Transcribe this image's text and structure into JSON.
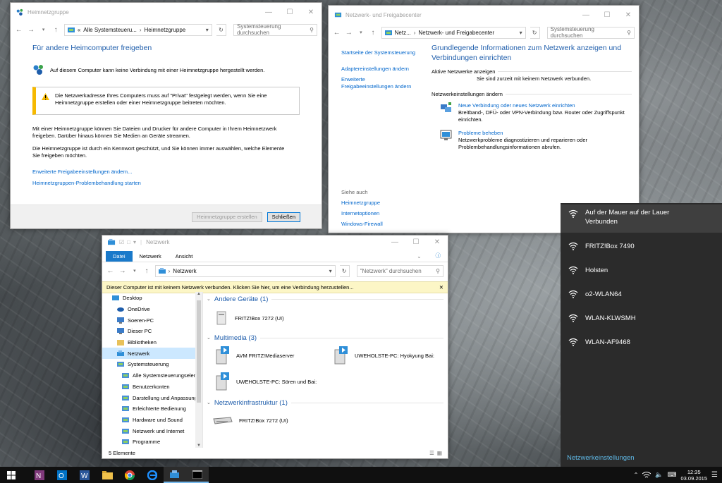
{
  "w1": {
    "title": "Heimnetzgruppe",
    "breadcrumb": [
      "«",
      "Alle Systemsteueru...",
      "Heimnetzgruppe"
    ],
    "search_placeholder": "Systemsteuerung durchsuchen",
    "heading": "Für andere Heimcomputer freigeben",
    "status": "Auf diesem Computer kann keine Verbindung mit einer Heimnetzgruppe hergestellt werden.",
    "warning_1": "Die Netzwerkadresse Ihres Computers muss auf \"Privat\" festgelegt werden, wenn Sie eine",
    "warning_2": "Heimnetzgruppe erstellen oder einer Heimnetzgruppe beitreten möchten.",
    "para1_1": "Mit einer Heimnetzgruppe können Sie Dateien und Drucker für andere Computer in Ihrem Heimnetzwerk",
    "para1_2": "freigeben. Darüber hinaus können Sie Medien an Geräte streamen.",
    "para2_1": "Die Heimnetzgruppe ist durch ein Kennwort geschützt, und Sie können immer auswählen, welche Elemente",
    "para2_2": "Sie freigeben möchten.",
    "link1": "Erweiterte Freigabeeinstellungen ändern...",
    "link2": "Heimnetzgruppen-Problembehandlung starten",
    "btn_create": "Heimnetzgruppe erstellen",
    "btn_close": "Schließen"
  },
  "w2": {
    "title": "Netzwerk- und Freigabecenter",
    "breadcrumb": [
      "Netz...",
      "Netzwerk- und Freigabecenter"
    ],
    "search_placeholder": "Systemsteuerung durchsuchen",
    "side": {
      "home": "Startseite der Systemsteuerung",
      "adapter": "Adaptereinstellungen ändern",
      "adv_1": "Erweiterte",
      "adv_2": "Freigabeeinstellungen ändern",
      "see_also": "Siehe auch",
      "homegroup": "Heimnetzgruppe",
      "internet": "Internetoptionen",
      "firewall": "Windows-Firewall"
    },
    "heading_1": "Grundlegende Informationen zum Netzwerk anzeigen und",
    "heading_2": "Verbindungen einrichten",
    "active_label": "Aktive Netzwerke anzeigen",
    "no_network": "Sie sind zurzeit mit keinem Netzwerk verbunden.",
    "change_label": "Netzwerkeinstellungen ändern",
    "task1_link": "Neue Verbindung oder neues Netzwerk einrichten",
    "task1_desc_1": "Breitband-, DFÜ- oder VPN-Verbindung bzw. Router oder Zugriffspunkt",
    "task1_desc_2": "einrichten.",
    "task2_link": "Probleme beheben",
    "task2_desc_1": "Netzwerkprobleme diagnostizieren und reparieren oder",
    "task2_desc_2": "Problembehandlungsinformationen abrufen."
  },
  "w3": {
    "title": "Netzwerk",
    "tabs": [
      "Datei",
      "Netzwerk",
      "Ansicht"
    ],
    "address": "Netzwerk",
    "search_placeholder": "\"Netzwerk\" durchsuchen",
    "notify": "Dieser Computer ist mit keinem Netzwerk verbunden. Klicken Sie hier, um eine Verbindung herzustellen...",
    "tree": [
      {
        "label": "Desktop",
        "indent": 0
      },
      {
        "label": "OneDrive",
        "indent": 1
      },
      {
        "label": "Soeren-PC",
        "indent": 1
      },
      {
        "label": "Dieser PC",
        "indent": 1
      },
      {
        "label": "Bibliotheken",
        "indent": 1
      },
      {
        "label": "Netzwerk",
        "indent": 1
      },
      {
        "label": "Systemsteuerung",
        "indent": 1
      },
      {
        "label": "Alle Systemsteuerungselemente",
        "indent": 2
      },
      {
        "label": "Benutzerkonten",
        "indent": 2
      },
      {
        "label": "Darstellung und Anpassung",
        "indent": 2
      },
      {
        "label": "Erleichterte Bedienung",
        "indent": 2
      },
      {
        "label": "Hardware und Sound",
        "indent": 2
      },
      {
        "label": "Netzwerk und Internet",
        "indent": 2
      },
      {
        "label": "Programme",
        "indent": 2
      }
    ],
    "group1": "Andere Geräte (1)",
    "group2": "Multimedia (3)",
    "group3": "Netzwerkinfrastruktur (1)",
    "dev_fritz1": "FRITZ!Box 7272 (UI)",
    "dev_avm": "AVM FRITZ!Mediaserver",
    "dev_uwe1": "UWEHOLSTE-PC: Hyokyung Bai:",
    "dev_uwe2": "UWEHOLSTE-PC: Sören und Bai:",
    "dev_fritz2": "FRITZ!Box 7272 (UI)",
    "status": "5 Elemente"
  },
  "flyout": {
    "networks": [
      {
        "name": "Auf der Mauer auf der Lauer",
        "sub": "Verbunden"
      },
      {
        "name": "FRITZ!Box 7490",
        "sub": ""
      },
      {
        "name": "Holsten",
        "sub": ""
      },
      {
        "name": "o2-WLAN64",
        "sub": ""
      },
      {
        "name": "WLAN-KLWSMH",
        "sub": ""
      },
      {
        "name": "WLAN-AF9468",
        "sub": ""
      }
    ],
    "settings": "Netzwerkeinstellungen"
  },
  "taskbar": {
    "time": "12:35",
    "date": "03.09.2015"
  },
  "colors": {
    "accent": "#1e5dab",
    "link": "#0066cc",
    "warning": "#f6b900",
    "flyout_bg": "#2b2b2b",
    "flyout_link": "#5fb8e6"
  }
}
